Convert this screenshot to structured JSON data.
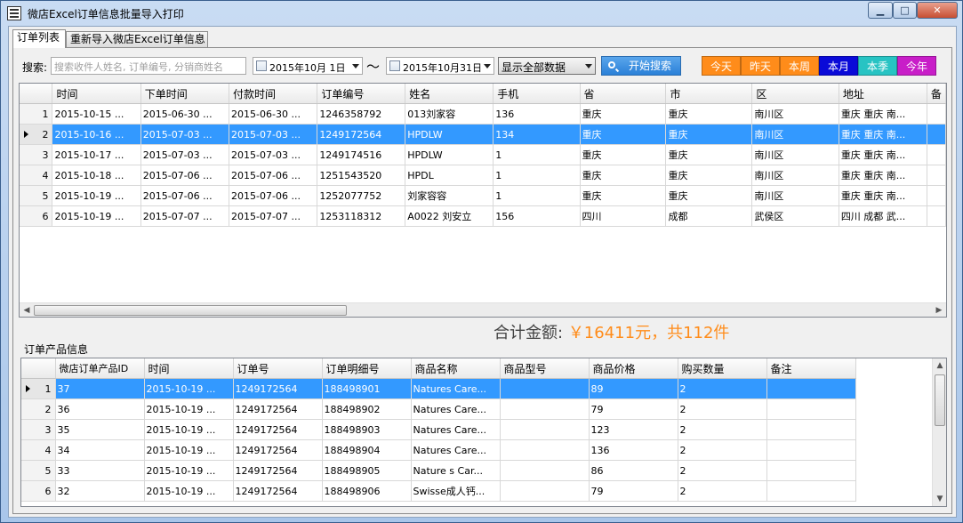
{
  "window": {
    "title": "微店Excel订单信息批量导入打印"
  },
  "tabs": [
    {
      "label": "订单列表"
    },
    {
      "label": "重新导入微店Excel订单信息"
    }
  ],
  "search": {
    "label": "搜索:",
    "placeholder": "搜索收件人姓名, 订单编号, 分销商姓名",
    "date_from": "2015年10月 1日",
    "date_sep": "～",
    "date_to": "2015年10月31日",
    "filter": "显示全部数据",
    "button": "开始搜索"
  },
  "quick_buttons": [
    {
      "label": "今天",
      "color": "#ff8c1a"
    },
    {
      "label": "昨天",
      "color": "#ff8c1a"
    },
    {
      "label": "本周",
      "color": "#ff8c1a"
    },
    {
      "label": "本月",
      "color": "#0a0ad8"
    },
    {
      "label": "本季",
      "color": "#27c3c3"
    },
    {
      "label": "今年",
      "color": "#c81ec8"
    }
  ],
  "orders": {
    "columns": [
      "时间",
      "下单时间",
      "付款时间",
      "订单编号",
      "姓名",
      "手机",
      "省",
      "市",
      "区",
      "地址",
      "备"
    ],
    "selected_row": 2,
    "rows": [
      {
        "n": "1",
        "cells": [
          "2015-10-15 ...",
          "2015-06-30 ...",
          "2015-06-30 ...",
          "1246358792",
          "013刘家容",
          "136",
          "重庆",
          "重庆",
          "南川区",
          "重庆 重庆 南..."
        ]
      },
      {
        "n": "2",
        "cells": [
          "2015-10-16 ...",
          "2015-07-03 ...",
          "2015-07-03 ...",
          "1249172564",
          "HPDLW",
          "134",
          "重庆",
          "重庆",
          "南川区",
          "重庆 重庆 南..."
        ]
      },
      {
        "n": "3",
        "cells": [
          "2015-10-17 ...",
          "2015-07-03 ...",
          "2015-07-03 ...",
          "1249174516",
          "HPDLW",
          "1",
          "重庆",
          "重庆",
          "南川区",
          "重庆 重庆 南..."
        ]
      },
      {
        "n": "4",
        "cells": [
          "2015-10-18 ...",
          "2015-07-06 ...",
          "2015-07-06 ...",
          "1251543520",
          "HPDL",
          "1",
          "重庆",
          "重庆",
          "南川区",
          "重庆 重庆 南..."
        ]
      },
      {
        "n": "5",
        "cells": [
          "2015-10-19 ...",
          "2015-07-06 ...",
          "2015-07-06 ...",
          "1252077752",
          "刘家容容",
          "1",
          "重庆",
          "重庆",
          "南川区",
          "重庆 重庆 南..."
        ]
      },
      {
        "n": "6",
        "cells": [
          "2015-10-19 ...",
          "2015-07-07 ...",
          "2015-07-07 ...",
          "1253118312",
          "A0022 刘安立",
          "156",
          "四川",
          "成都",
          "武侯区",
          "四川 成都 武..."
        ]
      }
    ]
  },
  "total": {
    "label": "合计金额:",
    "value": "￥16411元，共112件"
  },
  "products": {
    "group_label": "订单产品信息",
    "columns": [
      "微店订单产品ID",
      "时间",
      "订单号",
      "订单明细号",
      "商品名称",
      "商品型号",
      "商品价格",
      "购买数量",
      "备注"
    ],
    "selected_row": 1,
    "rows": [
      {
        "n": "1",
        "cells": [
          "37",
          "2015-10-19 ...",
          "1249172564",
          "188498901",
          "Natures Care...",
          "",
          "89",
          "2",
          ""
        ]
      },
      {
        "n": "2",
        "cells": [
          "36",
          "2015-10-19 ...",
          "1249172564",
          "188498902",
          "Natures Care...",
          "",
          "79",
          "2",
          ""
        ]
      },
      {
        "n": "3",
        "cells": [
          "35",
          "2015-10-19 ...",
          "1249172564",
          "188498903",
          "Natures Care...",
          "",
          "123",
          "2",
          ""
        ]
      },
      {
        "n": "4",
        "cells": [
          "34",
          "2015-10-19 ...",
          "1249172564",
          "188498904",
          "Natures Care...",
          "",
          "136",
          "2",
          ""
        ]
      },
      {
        "n": "5",
        "cells": [
          "33",
          "2015-10-19 ...",
          "1249172564",
          "188498905",
          "Nature s Car...",
          "",
          "86",
          "2",
          ""
        ]
      },
      {
        "n": "6",
        "cells": [
          "32",
          "2015-10-19 ...",
          "1249172564",
          "188498906",
          "Swisse成人钙...",
          "",
          "79",
          "2",
          ""
        ]
      }
    ]
  }
}
